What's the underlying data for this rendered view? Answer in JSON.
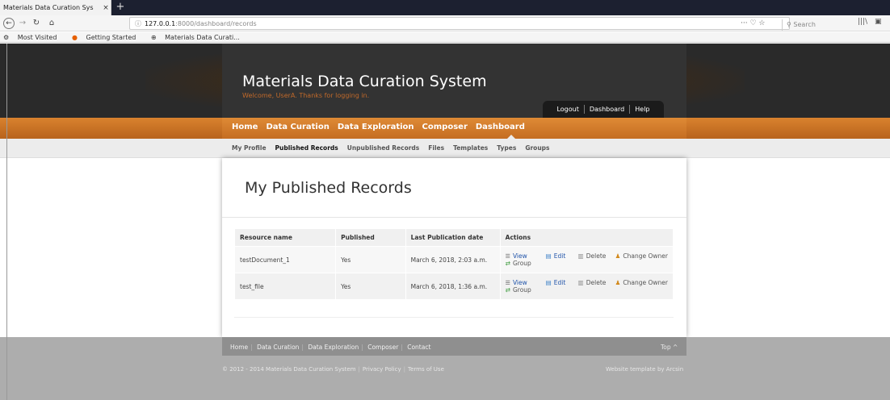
{
  "browser": {
    "tab_title": "Materials Data Curation Sys",
    "tab_close": "×",
    "new_tab": "+",
    "url_host": "127.0.0.1",
    "url_path": ":8000/dashboard/records",
    "url_tools": "···  ♡  ☆",
    "search_placeholder": "Search",
    "bookmarks": [
      "Most Visited",
      "Getting Started",
      "Materials Data Curati..."
    ]
  },
  "site": {
    "title": "Materials Data Curation System",
    "welcome": "Welcome, UserA. Thanks for logging in.",
    "user_links": [
      "Logout",
      "Dashboard",
      "Help"
    ]
  },
  "main_nav": [
    "Home",
    "Data Curation",
    "Data Exploration",
    "Composer",
    "Dashboard"
  ],
  "sub_nav": [
    "My Profile",
    "Published Records",
    "Unpublished Records",
    "Files",
    "Templates",
    "Types",
    "Groups"
  ],
  "page": {
    "heading": "My Published Records"
  },
  "table": {
    "headers": [
      "Resource name",
      "Published",
      "Last Publication date",
      "Actions"
    ],
    "rows": [
      {
        "name": "testDocument_1",
        "published": "Yes",
        "date": "March 6, 2018, 2:03 a.m."
      },
      {
        "name": "test_file",
        "published": "Yes",
        "date": "March 6, 2018, 1:36 a.m."
      }
    ],
    "actions": {
      "view": "View",
      "group": "Group",
      "edit": "Edit",
      "delete": "Delete",
      "change_owner": "Change Owner"
    }
  },
  "footer": {
    "links": [
      "Home",
      "Data Curation",
      "Data Exploration",
      "Composer",
      "Contact"
    ],
    "top": "Top ^",
    "copyright": "© 2012 - 2014 Materials Data Curation System",
    "privacy": "Privacy Policy",
    "terms": "Terms of Use",
    "template_credit": "Website template by Arcsin"
  }
}
